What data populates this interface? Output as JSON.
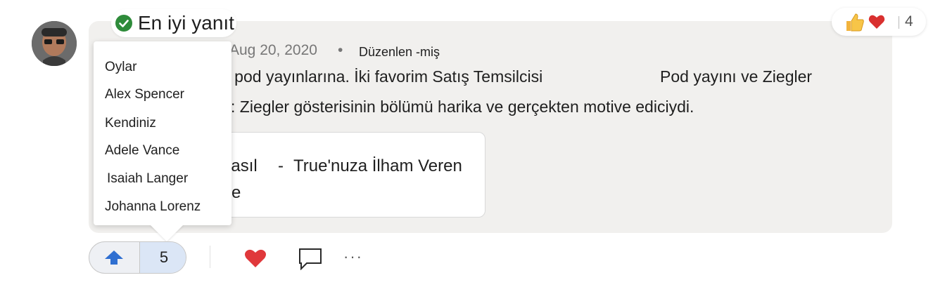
{
  "badge": {
    "label": "En iyi yanıt",
    "color": "#2e8b3a"
  },
  "reactions": {
    "count": "4"
  },
  "post": {
    "date": "Aug 20, 2020",
    "dot": "•",
    "edited": "Düzenlen -miş",
    "line1a": "g pod yayınlarına. İki favorim Satış Temsilcisi",
    "line1b": "Pod yayını ve Ziegler",
    "line2": ": Ziegler gösterisinin bölümü harika ve gerçekten motive ediciydi."
  },
  "link_card": {
    "t1": "nasıl",
    "dash": "-",
    "t2": "True'nuza İlham Veren",
    "t3": "e"
  },
  "voters_popup": {
    "header": "Oylar",
    "voters": [
      "Alex Spencer",
      "Kendiniz",
      "Adele Vance",
      "Isaiah Langer",
      "Johanna  Lorenz"
    ]
  },
  "vote": {
    "count": "5",
    "accent": "#2f6fd1"
  },
  "actions": {
    "more": "···"
  }
}
